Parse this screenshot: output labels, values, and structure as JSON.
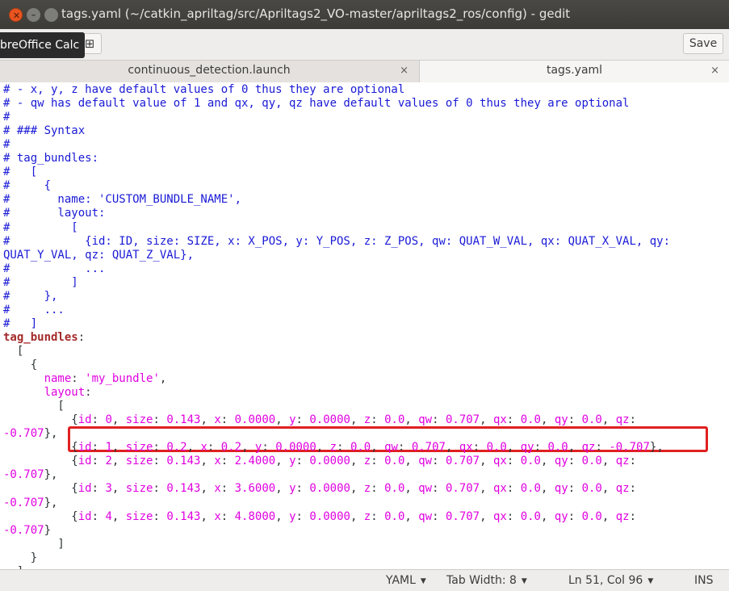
{
  "window": {
    "title": "tags.yaml (~/catkin_apriltag/src/Apriltags2_VO-master/apriltags2_ros/config) - gedit"
  },
  "header": {
    "save_label": "Save",
    "tooltip": "breOffice Calc"
  },
  "tabs": [
    {
      "label": "continuous_detection.launch",
      "close": "×"
    },
    {
      "label": "tags.yaml",
      "close": "×"
    }
  ],
  "editor": {
    "lines": [
      [
        [
          "cmt",
          "# - x, y, z have default values of 0 thus they are optional"
        ]
      ],
      [
        [
          "cmt",
          "# - qw has default value of 1 and qx, qy, qz have default values of 0 thus they are optional"
        ]
      ],
      [
        [
          "cmt",
          "#"
        ]
      ],
      [
        [
          "cmt",
          "# ### Syntax"
        ]
      ],
      [
        [
          "cmt",
          "#"
        ]
      ],
      [
        [
          "cmt",
          "# tag_bundles:"
        ]
      ],
      [
        [
          "cmt",
          "#   ["
        ]
      ],
      [
        [
          "cmt",
          "#     {"
        ]
      ],
      [
        [
          "cmt",
          "#       name: 'CUSTOM_BUNDLE_NAME',"
        ]
      ],
      [
        [
          "cmt",
          "#       layout:"
        ]
      ],
      [
        [
          "cmt",
          "#         ["
        ]
      ],
      [
        [
          "cmt",
          "#           {id: ID, size: SIZE, x: X_POS, y: Y_POS, z: Z_POS, qw: QUAT_W_VAL, qx: QUAT_X_VAL, qy:"
        ]
      ],
      [
        [
          "cmt",
          "QUAT_Y_VAL, qz: QUAT_Z_VAL},"
        ]
      ],
      [
        [
          "cmt",
          "#           ..."
        ]
      ],
      [
        [
          "cmt",
          "#         ]"
        ]
      ],
      [
        [
          "cmt",
          "#     },"
        ]
      ],
      [
        [
          "cmt",
          "#     ..."
        ]
      ],
      [
        [
          "cmt",
          "#   ]"
        ]
      ],
      [
        [
          "key",
          "tag_bundles"
        ],
        [
          "pl",
          ":"
        ]
      ],
      [
        [
          "pl",
          "  ["
        ]
      ],
      [
        [
          "pl",
          "    {"
        ]
      ],
      [
        [
          "kk",
          "      name"
        ],
        [
          "pl",
          ": "
        ],
        [
          "val",
          "'my_bundle'"
        ],
        [
          "pl",
          ","
        ]
      ],
      [
        [
          "kk",
          "      layout"
        ],
        [
          "pl",
          ":"
        ]
      ],
      [
        [
          "pl",
          "        ["
        ]
      ],
      [
        [
          "pl",
          "          {"
        ],
        [
          "kk",
          "id"
        ],
        [
          "pl",
          ": "
        ],
        [
          "val",
          "0"
        ],
        [
          "pl",
          ", "
        ],
        [
          "kk",
          "size"
        ],
        [
          "pl",
          ": "
        ],
        [
          "val",
          "0.143"
        ],
        [
          "pl",
          ", "
        ],
        [
          "kk",
          "x"
        ],
        [
          "pl",
          ": "
        ],
        [
          "val",
          "0.0000"
        ],
        [
          "pl",
          ", "
        ],
        [
          "kk",
          "y"
        ],
        [
          "pl",
          ": "
        ],
        [
          "val",
          "0.0000"
        ],
        [
          "pl",
          ", "
        ],
        [
          "kk",
          "z"
        ],
        [
          "pl",
          ": "
        ],
        [
          "val",
          "0.0"
        ],
        [
          "pl",
          ", "
        ],
        [
          "kk",
          "qw"
        ],
        [
          "pl",
          ": "
        ],
        [
          "val",
          "0.707"
        ],
        [
          "pl",
          ", "
        ],
        [
          "kk",
          "qx"
        ],
        [
          "pl",
          ": "
        ],
        [
          "val",
          "0.0"
        ],
        [
          "pl",
          ", "
        ],
        [
          "kk",
          "qy"
        ],
        [
          "pl",
          ": "
        ],
        [
          "val",
          "0.0"
        ],
        [
          "pl",
          ", "
        ],
        [
          "kk",
          "qz"
        ],
        [
          "pl",
          ":"
        ]
      ],
      [
        [
          "val",
          "-0.707"
        ],
        [
          "pl",
          "},"
        ]
      ],
      [
        [
          "pl",
          "          {"
        ],
        [
          "kk",
          "id"
        ],
        [
          "pl",
          ": "
        ],
        [
          "val",
          "1"
        ],
        [
          "pl",
          ", "
        ],
        [
          "kk",
          "size"
        ],
        [
          "pl",
          ": "
        ],
        [
          "val",
          "0.2"
        ],
        [
          "pl",
          ", "
        ],
        [
          "kk",
          "x"
        ],
        [
          "pl",
          ": "
        ],
        [
          "val",
          "0.2"
        ],
        [
          "pl",
          ", "
        ],
        [
          "kk",
          "y"
        ],
        [
          "pl",
          ": "
        ],
        [
          "val",
          "0.0000"
        ],
        [
          "pl",
          ", "
        ],
        [
          "kk",
          "z"
        ],
        [
          "pl",
          ": "
        ],
        [
          "val",
          "0.0"
        ],
        [
          "pl",
          ", "
        ],
        [
          "kk",
          "qw"
        ],
        [
          "pl",
          ": "
        ],
        [
          "val",
          "0.707"
        ],
        [
          "pl",
          ", "
        ],
        [
          "kk",
          "qx"
        ],
        [
          "pl",
          ": "
        ],
        [
          "val",
          "0.0"
        ],
        [
          "pl",
          ", "
        ],
        [
          "kk",
          "qy"
        ],
        [
          "pl",
          ": "
        ],
        [
          "val",
          "0.0"
        ],
        [
          "pl",
          ", "
        ],
        [
          "kk",
          "qz"
        ],
        [
          "pl",
          ": "
        ],
        [
          "val",
          "-0.707"
        ],
        [
          "pl",
          "},"
        ]
      ],
      [
        [
          "pl",
          "          {"
        ],
        [
          "kk",
          "id"
        ],
        [
          "pl",
          ": "
        ],
        [
          "val",
          "2"
        ],
        [
          "pl",
          ", "
        ],
        [
          "kk",
          "size"
        ],
        [
          "pl",
          ": "
        ],
        [
          "val",
          "0.143"
        ],
        [
          "pl",
          ", "
        ],
        [
          "kk",
          "x"
        ],
        [
          "pl",
          ": "
        ],
        [
          "val",
          "2.4000"
        ],
        [
          "pl",
          ", "
        ],
        [
          "kk",
          "y"
        ],
        [
          "pl",
          ": "
        ],
        [
          "val",
          "0.0000"
        ],
        [
          "pl",
          ", "
        ],
        [
          "kk",
          "z"
        ],
        [
          "pl",
          ": "
        ],
        [
          "val",
          "0.0"
        ],
        [
          "pl",
          ", "
        ],
        [
          "kk",
          "qw"
        ],
        [
          "pl",
          ": "
        ],
        [
          "val",
          "0.707"
        ],
        [
          "pl",
          ", "
        ],
        [
          "kk",
          "qx"
        ],
        [
          "pl",
          ": "
        ],
        [
          "val",
          "0.0"
        ],
        [
          "pl",
          ", "
        ],
        [
          "kk",
          "qy"
        ],
        [
          "pl",
          ": "
        ],
        [
          "val",
          "0.0"
        ],
        [
          "pl",
          ", "
        ],
        [
          "kk",
          "qz"
        ],
        [
          "pl",
          ":"
        ]
      ],
      [
        [
          "val",
          "-0.707"
        ],
        [
          "pl",
          "},"
        ]
      ],
      [
        [
          "pl",
          "          {"
        ],
        [
          "kk",
          "id"
        ],
        [
          "pl",
          ": "
        ],
        [
          "val",
          "3"
        ],
        [
          "pl",
          ", "
        ],
        [
          "kk",
          "size"
        ],
        [
          "pl",
          ": "
        ],
        [
          "val",
          "0.143"
        ],
        [
          "pl",
          ", "
        ],
        [
          "kk",
          "x"
        ],
        [
          "pl",
          ": "
        ],
        [
          "val",
          "3.6000"
        ],
        [
          "pl",
          ", "
        ],
        [
          "kk",
          "y"
        ],
        [
          "pl",
          ": "
        ],
        [
          "val",
          "0.0000"
        ],
        [
          "pl",
          ", "
        ],
        [
          "kk",
          "z"
        ],
        [
          "pl",
          ": "
        ],
        [
          "val",
          "0.0"
        ],
        [
          "pl",
          ", "
        ],
        [
          "kk",
          "qw"
        ],
        [
          "pl",
          ": "
        ],
        [
          "val",
          "0.707"
        ],
        [
          "pl",
          ", "
        ],
        [
          "kk",
          "qx"
        ],
        [
          "pl",
          ": "
        ],
        [
          "val",
          "0.0"
        ],
        [
          "pl",
          ", "
        ],
        [
          "kk",
          "qy"
        ],
        [
          "pl",
          ": "
        ],
        [
          "val",
          "0.0"
        ],
        [
          "pl",
          ", "
        ],
        [
          "kk",
          "qz"
        ],
        [
          "pl",
          ":"
        ]
      ],
      [
        [
          "val",
          "-0.707"
        ],
        [
          "pl",
          "},"
        ]
      ],
      [
        [
          "pl",
          "          {"
        ],
        [
          "kk",
          "id"
        ],
        [
          "pl",
          ": "
        ],
        [
          "val",
          "4"
        ],
        [
          "pl",
          ", "
        ],
        [
          "kk",
          "size"
        ],
        [
          "pl",
          ": "
        ],
        [
          "val",
          "0.143"
        ],
        [
          "pl",
          ", "
        ],
        [
          "kk",
          "x"
        ],
        [
          "pl",
          ": "
        ],
        [
          "val",
          "4.8000"
        ],
        [
          "pl",
          ", "
        ],
        [
          "kk",
          "y"
        ],
        [
          "pl",
          ": "
        ],
        [
          "val",
          "0.0000"
        ],
        [
          "pl",
          ", "
        ],
        [
          "kk",
          "z"
        ],
        [
          "pl",
          ": "
        ],
        [
          "val",
          "0.0"
        ],
        [
          "pl",
          ", "
        ],
        [
          "kk",
          "qw"
        ],
        [
          "pl",
          ": "
        ],
        [
          "val",
          "0.707"
        ],
        [
          "pl",
          ", "
        ],
        [
          "kk",
          "qx"
        ],
        [
          "pl",
          ": "
        ],
        [
          "val",
          "0.0"
        ],
        [
          "pl",
          ", "
        ],
        [
          "kk",
          "qy"
        ],
        [
          "pl",
          ": "
        ],
        [
          "val",
          "0.0"
        ],
        [
          "pl",
          ", "
        ],
        [
          "kk",
          "qz"
        ],
        [
          "pl",
          ":"
        ]
      ],
      [
        [
          "val",
          "-0.707"
        ],
        [
          "pl",
          "}"
        ]
      ],
      [
        [
          "pl",
          "        ]"
        ]
      ],
      [
        [
          "pl",
          "    }"
        ]
      ],
      [
        [
          "pl",
          "  ]"
        ]
      ]
    ]
  },
  "statusbar": {
    "language": "YAML",
    "tab_width": "Tab Width: 8",
    "position": "Ln 51, Col 96",
    "mode": "INS"
  }
}
